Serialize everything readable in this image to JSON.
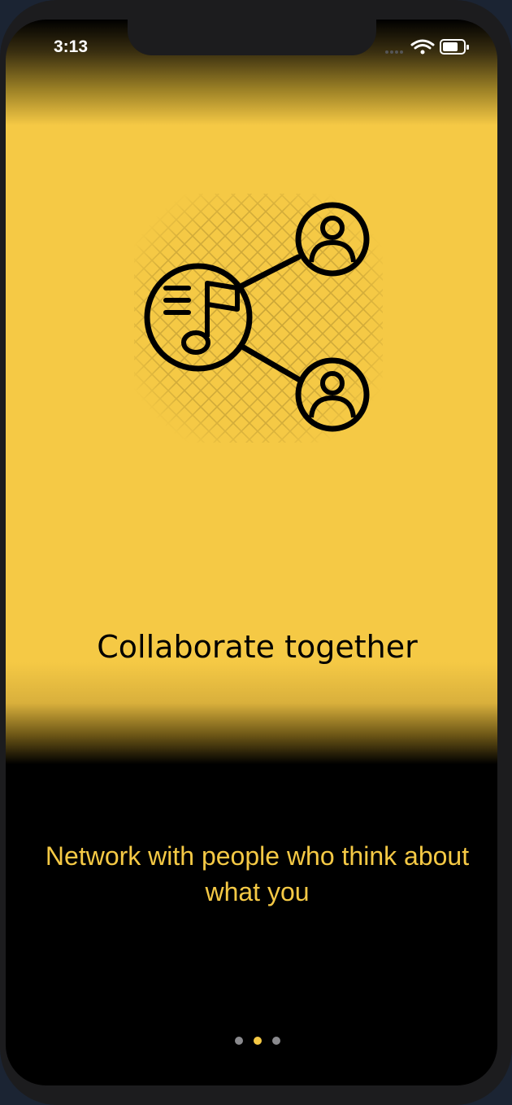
{
  "status_bar": {
    "time": "3:13",
    "icons": [
      "cellular-signal-icon",
      "wifi-icon",
      "battery-icon"
    ]
  },
  "onboarding": {
    "illustration": "music-collaboration-network-icon",
    "title": "Collaborate together",
    "subtitle": "Network with people who think about what you",
    "page_indicator": {
      "total_pages": 3,
      "current_page": 2
    }
  },
  "colors": {
    "accent_yellow": "#f5c945",
    "background_black": "#000000",
    "inactive_dot": "#8a8a8e"
  }
}
